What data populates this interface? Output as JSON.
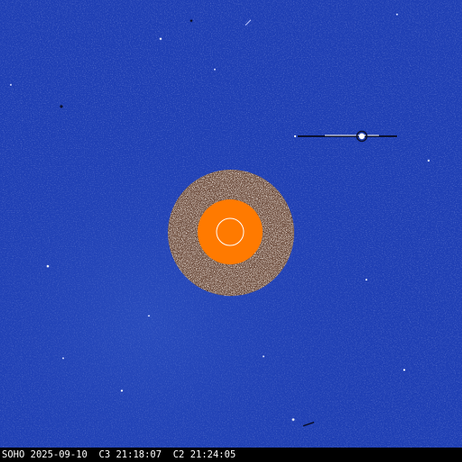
{
  "caption": {
    "observatory": "SOHO",
    "date": "2025-09-10",
    "c3_label": "C3",
    "c3_time": "21:18:07",
    "c2_label": "C2",
    "c2_time": "21:24:05"
  },
  "colors": {
    "background_blue": "#1f3fb4",
    "occulter_orange": "#ff7a00",
    "sun_outline": "#ffffff",
    "caption_bar": "#000000",
    "caption_text": "#ffffff"
  }
}
